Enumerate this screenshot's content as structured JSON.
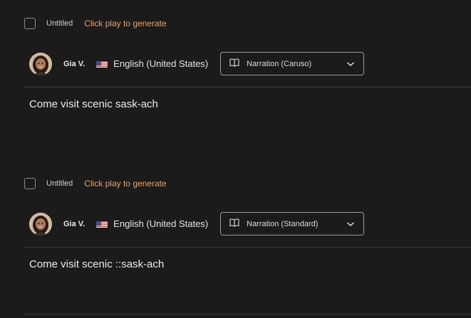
{
  "clips": [
    {
      "title": "Untitled",
      "status": "Click play to generate",
      "voice_name": "Gia V.",
      "language": "English (United States)",
      "style": "Narration (Caruso)",
      "script": "Come visit scenic sask-ach"
    },
    {
      "title": "Untitled",
      "status": "Click play to generate",
      "voice_name": "Gia V.",
      "language": "English (United States)",
      "style": "Narration (Standard)",
      "script": "Come visit scenic ::sask-ach"
    }
  ],
  "icons": {
    "style": "book-icon",
    "dropdown": "chevron-down-icon",
    "flag": "us-flag-icon",
    "avatar": "avatar"
  },
  "colors": {
    "background": "#1c1b1b",
    "status_accent": "#f0a15a",
    "border": "#9a9a9a"
  }
}
